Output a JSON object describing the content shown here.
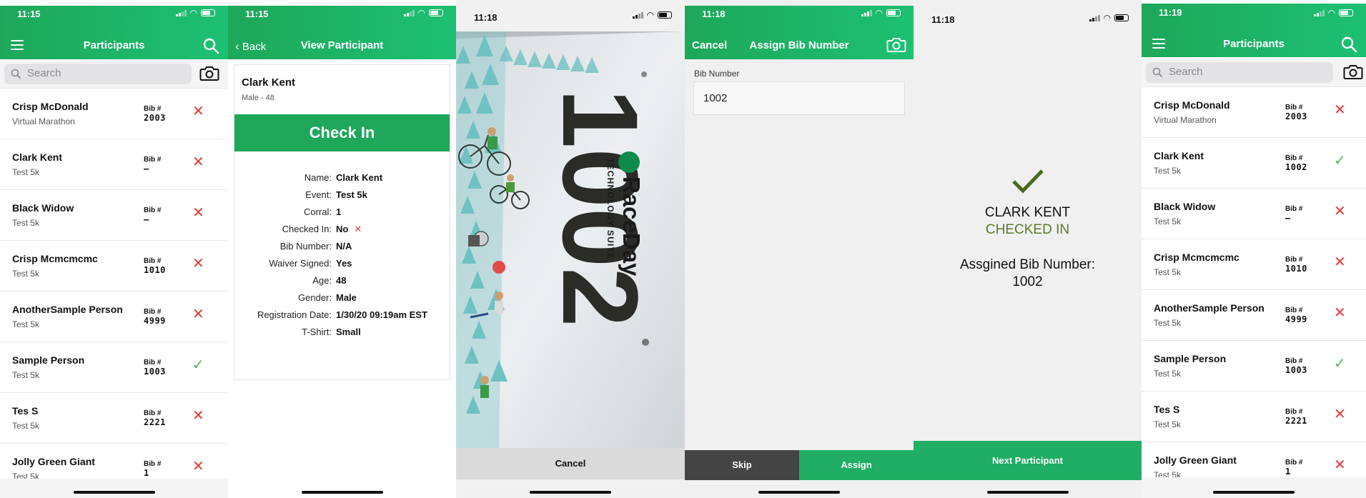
{
  "colors": {
    "brand_green": "#1fae63",
    "error_red": "#e53935",
    "ok_green": "#4cbb5a",
    "checked_in_olive": "#5a7a2a"
  },
  "screen1": {
    "time": "11:15",
    "title": "Participants",
    "search_placeholder": "Search",
    "bib_label": "Bib #",
    "participants": [
      {
        "name": "Crisp McDonald",
        "event": "Virtual Marathon",
        "bib": "2003",
        "checked_in": false,
        "status_glyph": "✕"
      },
      {
        "name": "Clark Kent",
        "event": "Test 5k",
        "bib": "–",
        "checked_in": false,
        "status_glyph": "✕"
      },
      {
        "name": "Black Widow",
        "event": "Test 5k",
        "bib": "–",
        "checked_in": false,
        "status_glyph": "✕"
      },
      {
        "name": "Crisp Mcmcmcmc",
        "event": "Test 5k",
        "bib": "1010",
        "checked_in": false,
        "status_glyph": "✕"
      },
      {
        "name": "AnotherSample Person",
        "event": "Test 5k",
        "bib": "4999",
        "checked_in": false,
        "status_glyph": "✕"
      },
      {
        "name": "Sample Person",
        "event": "Test 5k",
        "bib": "1003",
        "checked_in": true,
        "status_glyph": "✓"
      },
      {
        "name": "Tes S",
        "event": "Test 5k",
        "bib": "2221",
        "checked_in": false,
        "status_glyph": "✕"
      },
      {
        "name": "Jolly Green Giant",
        "event": "Test 5k",
        "bib": "1",
        "checked_in": false,
        "status_glyph": "✕"
      }
    ]
  },
  "screen2": {
    "time": "11:15",
    "back_label": "Back",
    "title": "View Participant",
    "participant_name": "Clark Kent",
    "participant_sub": "Male - 48",
    "checkin_label": "Check In",
    "details": [
      {
        "label": "Name:",
        "value": "Clark Kent"
      },
      {
        "label": "Event:",
        "value": "Test 5k"
      },
      {
        "label": "Corral:",
        "value": "1"
      },
      {
        "label": "Checked In:",
        "value": "No",
        "glyph": "✕"
      },
      {
        "label": "Bib Number:",
        "value": "N/A"
      },
      {
        "label": "Waiver Signed:",
        "value": "Yes"
      },
      {
        "label": "Age:",
        "value": "48"
      },
      {
        "label": "Gender:",
        "value": "Male"
      },
      {
        "label": "Registration Date:",
        "value": "1/30/20 09:19am EST"
      },
      {
        "label": "T-Shirt:",
        "value": "Small"
      }
    ]
  },
  "screen3": {
    "time": "11:18",
    "bib_number": "1002",
    "logo_text": "RaceDay",
    "logo_sub": "TECHNOLOGY SUITE",
    "cancel_label": "Cancel"
  },
  "screen4": {
    "time": "11:18",
    "cancel_label": "Cancel",
    "title": "Assign Bib Number",
    "field_label": "Bib Number",
    "field_value": "1002",
    "skip_label": "Skip",
    "assign_label": "Assign"
  },
  "screen5": {
    "time": "11:18",
    "name": "CLARK KENT",
    "status": "CHECKED IN",
    "bib_label": "Assgined Bib Number:",
    "bib_value": "1002",
    "next_label": "Next Participant"
  },
  "screen6": {
    "time": "11:19",
    "title": "Participants",
    "search_placeholder": "Search",
    "bib_label": "Bib #",
    "participants": [
      {
        "name": "Crisp McDonald",
        "event": "Virtual Marathon",
        "bib": "2003",
        "checked_in": false,
        "status_glyph": "✕"
      },
      {
        "name": "Clark Kent",
        "event": "Test 5k",
        "bib": "1002",
        "checked_in": true,
        "status_glyph": "✓"
      },
      {
        "name": "Black Widow",
        "event": "Test 5k",
        "bib": "–",
        "checked_in": false,
        "status_glyph": "✕"
      },
      {
        "name": "Crisp Mcmcmcmc",
        "event": "Test 5k",
        "bib": "1010",
        "checked_in": false,
        "status_glyph": "✕"
      },
      {
        "name": "AnotherSample Person",
        "event": "Test 5k",
        "bib": "4999",
        "checked_in": false,
        "status_glyph": "✕"
      },
      {
        "name": "Sample Person",
        "event": "Test 5k",
        "bib": "1003",
        "checked_in": true,
        "status_glyph": "✓"
      },
      {
        "name": "Tes S",
        "event": "Test 5k",
        "bib": "2221",
        "checked_in": false,
        "status_glyph": "✕"
      },
      {
        "name": "Jolly Green Giant",
        "event": "Test 5k",
        "bib": "1",
        "checked_in": false,
        "status_glyph": "✕"
      }
    ]
  }
}
